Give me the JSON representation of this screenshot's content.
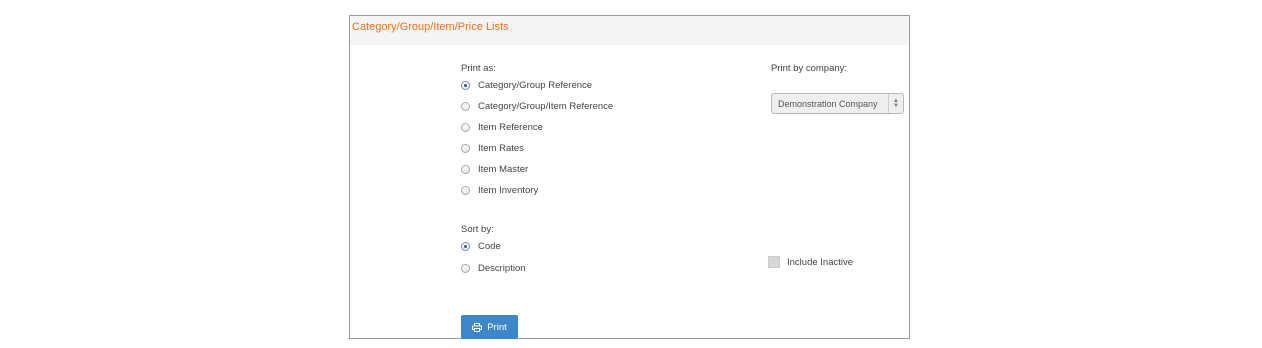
{
  "panel": {
    "title": "Category/Group/Item/Price Lists"
  },
  "print_as": {
    "label": "Print as:",
    "options": [
      {
        "label": "Category/Group Reference",
        "checked": true
      },
      {
        "label": "Category/Group/Item Reference",
        "checked": false
      },
      {
        "label": "Item Reference",
        "checked": false
      },
      {
        "label": "Item Rates",
        "checked": false
      },
      {
        "label": "Item Master",
        "checked": false
      },
      {
        "label": "Item Inventory",
        "checked": false
      }
    ]
  },
  "sort_by": {
    "label": "Sort by:",
    "options": [
      {
        "label": "Code",
        "checked": true
      },
      {
        "label": "Description",
        "checked": false
      }
    ]
  },
  "company": {
    "label": "Print by company:",
    "selected": "Demonstration Company"
  },
  "include_inactive": {
    "label": "Include Inactive",
    "checked": false
  },
  "print_button": {
    "label": "Print",
    "icon": "printer-icon"
  },
  "colors": {
    "title": "#e8731f",
    "button": "#3d87c8",
    "header_bg": "#f5f5f5"
  }
}
